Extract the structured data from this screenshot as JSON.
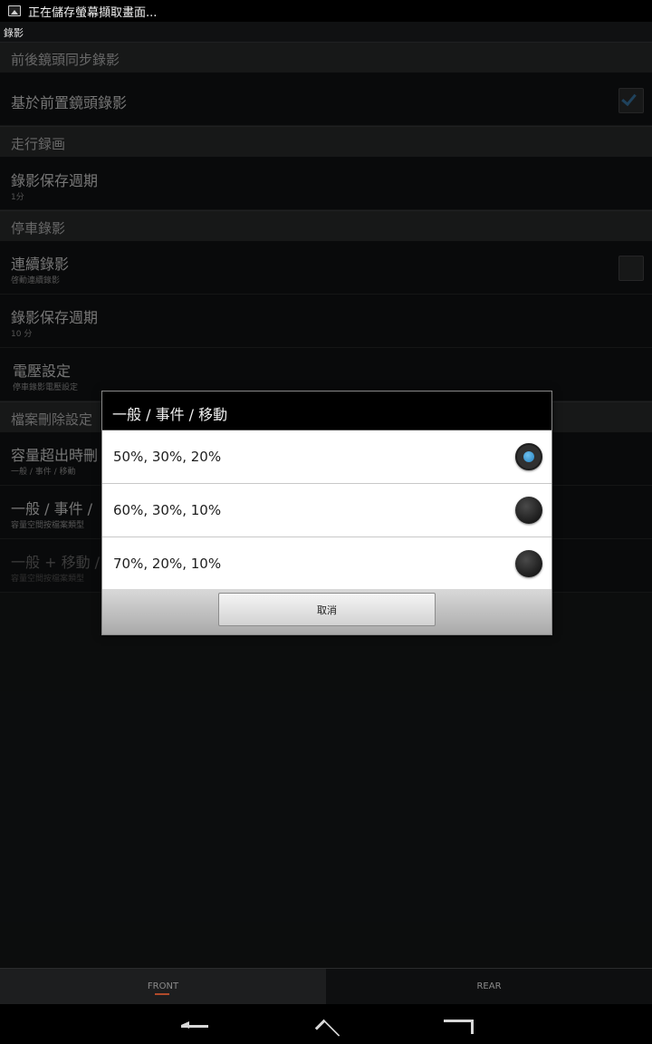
{
  "status_bar": {
    "notification_icon": "image-icon",
    "text": "正在儲存螢幕擷取畫面..."
  },
  "action_bar": {
    "title": "錄影"
  },
  "preferences": {
    "sections": [
      {
        "header": "前後鏡頭同步錄影",
        "rows": [
          {
            "title": "基於前置鏡頭錄影",
            "summary": "",
            "checkbox": true,
            "checked": true
          }
        ]
      },
      {
        "header": "走行録画",
        "rows": [
          {
            "title": "錄影保存週期",
            "summary": "1分"
          }
        ]
      },
      {
        "header": "停車錄影",
        "rows": [
          {
            "title": "連續錄影",
            "summary": "啓動連續錄影",
            "checkbox": true,
            "checked": false
          },
          {
            "title": "錄影保存週期",
            "summary": "10 分"
          },
          {
            "title": "電壓設定",
            "summary": "停車錄影電壓設定"
          }
        ]
      },
      {
        "header": "檔案刪除設定",
        "rows": [
          {
            "title": "容量超出時刪",
            "summary": "一般 / 事件 / 移動"
          },
          {
            "title": "一般 / 事件 /",
            "summary": "容量空間按檔案類型"
          },
          {
            "title": "一般 + 移動 /",
            "summary": "容量空間按檔案類型",
            "disabled": true
          }
        ]
      }
    ]
  },
  "dialog": {
    "title": "一般 / 事件 / 移動",
    "options": [
      {
        "label": "50%, 30%, 20%",
        "selected": true
      },
      {
        "label": "60%, 30%, 10%",
        "selected": false
      },
      {
        "label": "70%, 20%, 10%",
        "selected": false
      }
    ],
    "cancel_label": "取消"
  },
  "bottom_tabs": [
    {
      "label": "FRONT",
      "active": true
    },
    {
      "label": "REAR",
      "active": false
    }
  ],
  "navigation": {
    "back": "back-icon",
    "home": "home-icon",
    "recent": "recent-apps-icon"
  }
}
